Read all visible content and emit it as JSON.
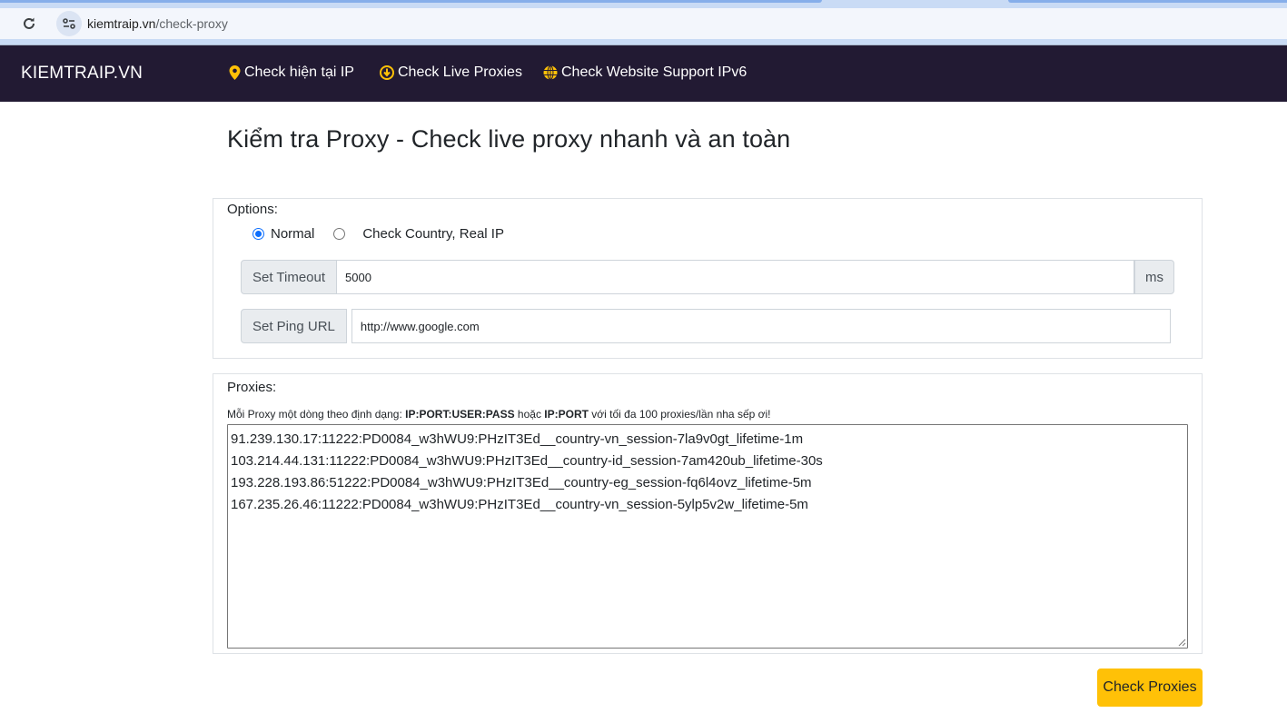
{
  "browser": {
    "url_host": "kiemtraip.vn",
    "url_path": "/check-proxy",
    "reload_icon": "reload-icon",
    "site_info_icon": "tune-icon"
  },
  "navbar": {
    "brand": "KIEMTRAIP.VN",
    "items": [
      {
        "label": "Check hiện tại IP",
        "icon": "map-marker-icon"
      },
      {
        "label": "Check Live Proxies",
        "icon": "arrow-circle-icon"
      },
      {
        "label": "Check Website Support IPv6",
        "icon": "globe-icon"
      }
    ],
    "icon_color": "#ffc107",
    "background": "#221a33"
  },
  "page": {
    "title": "Kiểm tra Proxy - Check live proxy nhanh và an toàn"
  },
  "options": {
    "label": "Options:",
    "radios": [
      {
        "label": "Normal",
        "checked": true
      },
      {
        "label": "Check Country, Real IP",
        "checked": false
      }
    ],
    "timeout": {
      "addon": "Set Timeout",
      "value": "5000",
      "unit": "ms"
    },
    "ping_url": {
      "addon": "Set Ping URL",
      "value": "http://www.google.com"
    }
  },
  "proxies": {
    "label": "Proxies:",
    "hint": {
      "prefix": "Mỗi Proxy một dòng theo định dạng: ",
      "format1": "IP:PORT:USER:PASS",
      "middle": " hoặc ",
      "format2": "IP:PORT",
      "suffix": " với tối đa 100 proxies/lần nha sếp ơi!"
    },
    "lines": [
      "91.239.130.17:11222:PD0084_w3hWU9:PHzIT3Ed__country-vn_session-7la9v0gt_lifetime-1m",
      "103.214.44.131:11222:PD0084_w3hWU9:PHzIT3Ed__country-id_session-7am420ub_lifetime-30s",
      "193.228.193.86:51222:PD0084_w3hWU9:PHzIT3Ed__country-eg_session-fq6l4ovz_lifetime-5m",
      "167.235.26.46:11222:PD0084_w3hWU9:PHzIT3Ed__country-vn_session-5ylp5v2w_lifetime-5m"
    ]
  },
  "actions": {
    "check_button": "Check Proxies",
    "check_button_color": "#ffc107"
  }
}
